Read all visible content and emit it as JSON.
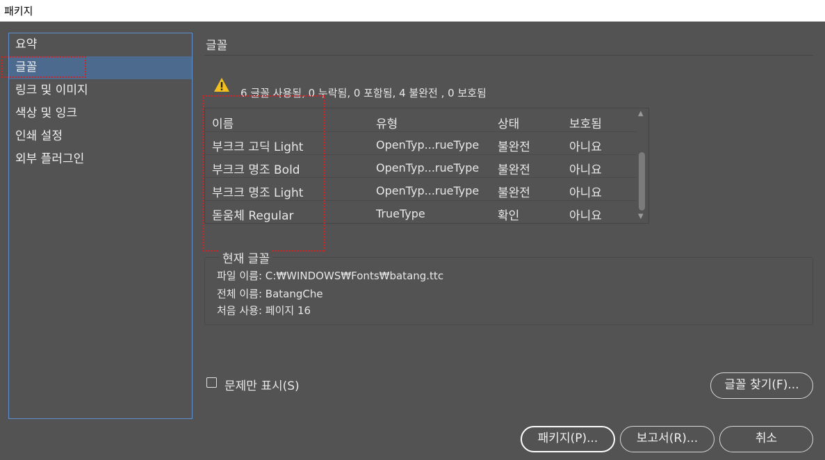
{
  "window": {
    "title": "패키지"
  },
  "sidebar": {
    "items": [
      {
        "label": "요약",
        "selected": false
      },
      {
        "label": "글꼴",
        "selected": true
      },
      {
        "label": "링크 및 이미지",
        "selected": false
      },
      {
        "label": "색상 및 잉크",
        "selected": false
      },
      {
        "label": "인쇄 설정",
        "selected": false
      },
      {
        "label": "외부 플러그인",
        "selected": false
      }
    ]
  },
  "main": {
    "section_title": "글꼴",
    "summary": "6 글꼴 사용됨, 0 누락됨, 0 포함됨, 4 불완전 , 0 보호됨",
    "table": {
      "headers": {
        "name": "이름",
        "type": "유형",
        "status": "상태",
        "protected": "보호됨"
      },
      "rows": [
        {
          "name": "부크크 고딕 Light",
          "type": "OpenTyp...rueType",
          "status": "불완전",
          "protected": "아니요"
        },
        {
          "name": "부크크 명조 Bold",
          "type": "OpenTyp...rueType",
          "status": "불완전",
          "protected": "아니요"
        },
        {
          "name": "부크크 명조 Light",
          "type": "OpenTyp...rueType",
          "status": "불완전",
          "protected": "아니요"
        },
        {
          "name": "돋움체 Regular",
          "type": "TrueType",
          "status": "확인",
          "protected": "아니요"
        }
      ]
    },
    "current_font": {
      "title": "현재 글꼴",
      "file_name": "파일 이름: C:₩WINDOWS₩Fonts₩batang.ttc",
      "full_name": "전체 이름: BatangChe",
      "first_use": "처음 사용: 페이지 16"
    },
    "show_problems_only": {
      "label": "문제만 표시(S)",
      "checked": false
    },
    "find_font_button": "글꼴 찾기(F)..."
  },
  "footer": {
    "package_button": "패키지(P)...",
    "report_button": "보고서(R)...",
    "cancel_button": "취소"
  },
  "colors": {
    "background": "#535353",
    "selection": "#4b6a8e",
    "sidebar_border": "#5e8fcf",
    "annotation": "#d82020",
    "warning": "#f2c01e"
  }
}
